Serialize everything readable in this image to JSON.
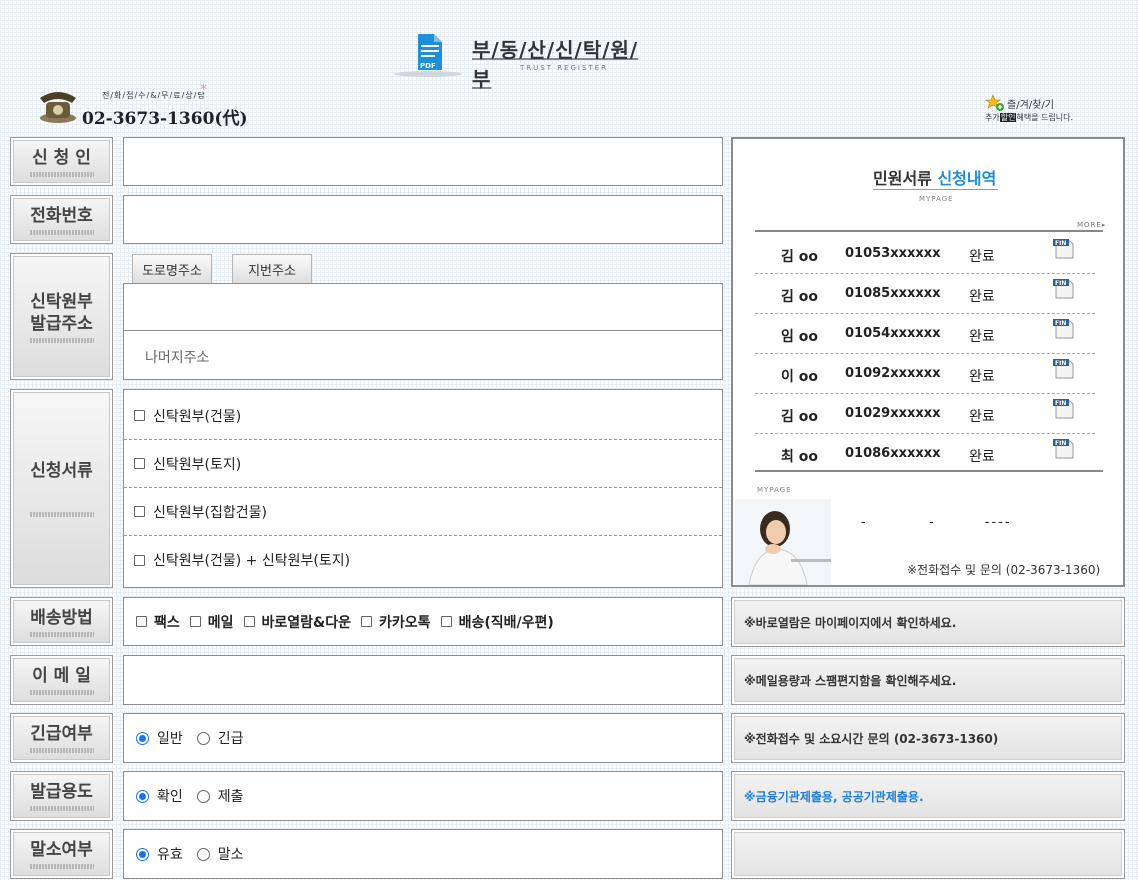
{
  "header": {
    "title": "부/동/산/신/탁/원/부",
    "subtitle": "TRUST REGISTER",
    "pdf_label": "PDF",
    "phone_caption": "전/화/접/수/&/무/료/상/담",
    "phone_number": "02-3673-1360(代)",
    "favorites_label": "즐/겨/찾/기",
    "favorites_sub_pre": "추가",
    "favorites_sub_hl": "할인",
    "favorites_sub_post": "혜택을 드립니다."
  },
  "form": {
    "applicant": {
      "label": "신 청 인",
      "value": ""
    },
    "phone": {
      "label": "전화번호",
      "value": ""
    },
    "address": {
      "label_line1": "신탁원부",
      "label_line2": "발급주소",
      "tab_road": "도로명주소",
      "tab_lot": "지번주소",
      "value": "",
      "detail_placeholder": "나머지주소"
    },
    "documents": {
      "label": "신청서류",
      "items": [
        "신탁원부(건물)",
        "신탁원부(토지)",
        "신탁원부(집합건물)",
        "신탁원부(건물) + 신탁원부(토지)"
      ]
    },
    "delivery": {
      "label": "배송방법",
      "options": [
        "팩스",
        "메일",
        "바로열람&다운",
        "카카오톡",
        "배송(직배/우편)"
      ]
    },
    "email": {
      "label": "이 메 일",
      "value": ""
    },
    "urgency": {
      "label": "긴급여부",
      "options": [
        "일반",
        "긴급"
      ],
      "selected": "일반"
    },
    "purpose": {
      "label": "발급용도",
      "options": [
        "확인",
        "제출"
      ],
      "selected": "확인"
    },
    "cancellation": {
      "label": "말소여부",
      "options": [
        "유효",
        "말소"
      ],
      "selected": "유효"
    }
  },
  "panel": {
    "title_pre": "민원서류 ",
    "title_hl": "신청내역",
    "mypage": "MYPAGE",
    "more": "MORE▸",
    "rows": [
      {
        "name": "김 oo",
        "phone": "01053xxxxxx",
        "status": "완료"
      },
      {
        "name": "김 oo",
        "phone": "01085xxxxxx",
        "status": "완료"
      },
      {
        "name": "임 oo",
        "phone": "01054xxxxxx",
        "status": "완료"
      },
      {
        "name": "이 oo",
        "phone": "01092xxxxxx",
        "status": "완료"
      },
      {
        "name": "김 oo",
        "phone": "01029xxxxxx",
        "status": "완료"
      },
      {
        "name": "최 oo",
        "phone": "01086xxxxxx",
        "status": "완료"
      }
    ],
    "fin_label": "FIN",
    "mypage2": "MYPAGE",
    "dash_text": "-          -        ----",
    "contact": "※전화접수 및 문의 (02-3673-1360)"
  },
  "notes": {
    "delivery": "※바로열람은 마이페이지에서 확인하세요.",
    "email": "※메일용량과 스팸편지함을 확인해주세요.",
    "urgency": "※전화접수 및 소요시간 문의 (02-3673-1360)",
    "purpose": "※금융기관제출용, 공공기관제출용.",
    "cancellation": ""
  },
  "colors": {
    "accent_blue": "#1d8fd0",
    "radio_blue": "#1a73e8"
  }
}
